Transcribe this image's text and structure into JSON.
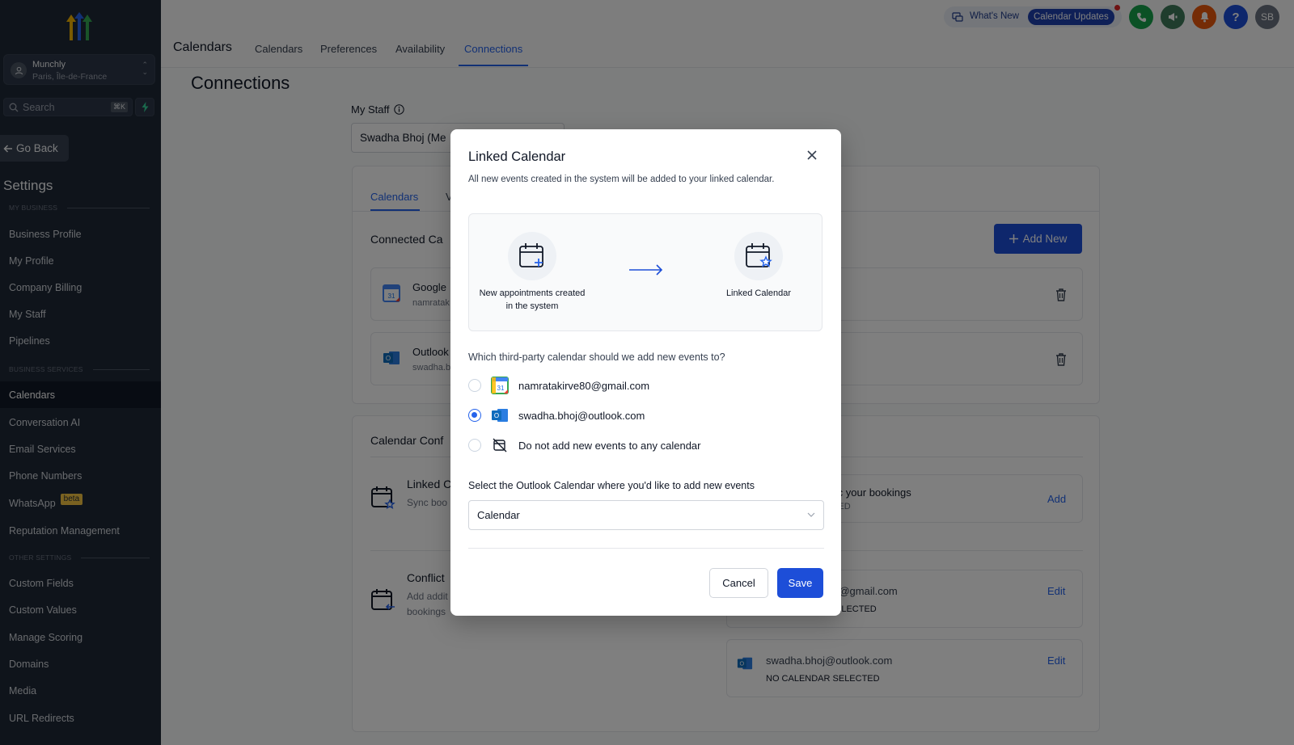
{
  "sidebar": {
    "location_name": "Munchly",
    "location_sub": "Paris, Île-de-France",
    "search_placeholder": "Search",
    "search_shortcut": "⌘K",
    "go_back": "Go Back",
    "settings_title": "Settings",
    "sections": {
      "my_business": "MY BUSINESS",
      "business_services": "BUSINESS SERVICES",
      "other_settings": "OTHER SETTINGS"
    },
    "items": [
      {
        "label": "Business Profile"
      },
      {
        "label": "My Profile"
      },
      {
        "label": "Company Billing"
      },
      {
        "label": "My Staff"
      },
      {
        "label": "Pipelines"
      },
      {
        "label": "Calendars"
      },
      {
        "label": "Conversation AI"
      },
      {
        "label": "Email Services"
      },
      {
        "label": "Phone Numbers"
      },
      {
        "label": "WhatsApp"
      },
      {
        "label": "Reputation Management"
      },
      {
        "label": "Custom Fields"
      },
      {
        "label": "Custom Values"
      },
      {
        "label": "Manage Scoring"
      },
      {
        "label": "Domains"
      },
      {
        "label": "Media"
      },
      {
        "label": "URL Redirects"
      }
    ],
    "beta_badge": "beta"
  },
  "topbar": {
    "app_title": "Calendars",
    "tabs": [
      {
        "label": "Calendars"
      },
      {
        "label": "Preferences"
      },
      {
        "label": "Availability"
      },
      {
        "label": "Connections"
      }
    ],
    "whats_new": "What's New",
    "calendar_updates": "Calendar Updates",
    "avatar_initials": "SB",
    "help_glyph": "?"
  },
  "page": {
    "title": "Connections",
    "staff_label": "My Staff",
    "staff_value": "Swadha Bhoj (Me",
    "inner_tabs": [
      {
        "label": "Calendars"
      },
      {
        "label": "V"
      }
    ],
    "connected_title": "Connected Ca",
    "add_new": "Add New",
    "connected": [
      {
        "name": "Google",
        "email": "namratak"
      },
      {
        "name": "Outlook",
        "email": "swadha.b"
      }
    ],
    "config_title": "Calendar Conf",
    "linked_title": "Linked C",
    "linked_sub": "Sync boo",
    "linked_right_title": "to sync your bookings",
    "linked_right_sub": "ELECTED",
    "linked_action": "Add",
    "conflict_title": "Conflict",
    "conflict_sub1": "Add addit",
    "conflict_sub2": "bookings",
    "conflict_rows": [
      {
        "email": ")@gmail.com",
        "status": "ELECTED",
        "action": "Edit"
      },
      {
        "email": "swadha.bhoj@outlook.com",
        "status": "NO CALENDAR SELECTED",
        "action": "Edit"
      }
    ]
  },
  "modal": {
    "title": "Linked Calendar",
    "description": "All new events created in the system will be added to your linked calendar.",
    "illus_left": "New appointments created in the system",
    "illus_right": "Linked Calendar",
    "question": "Which third-party calendar should we add new events to?",
    "options": [
      {
        "label": "namratakirve80@gmail.com",
        "checked": false
      },
      {
        "label": "swadha.bhoj@outlook.com",
        "checked": true
      },
      {
        "label": "Do not add new events to any calendar",
        "checked": false
      }
    ],
    "select_label": "Select the Outlook Calendar where you'd like to add new events",
    "select_value": "Calendar",
    "cancel": "Cancel",
    "save": "Save"
  },
  "colors": {
    "sidebar_bg": "#1f2937",
    "accent": "#1d4ed8",
    "link": "#2563eb",
    "google_green": "#34a853",
    "outlook_blue": "#0f6cbd"
  }
}
